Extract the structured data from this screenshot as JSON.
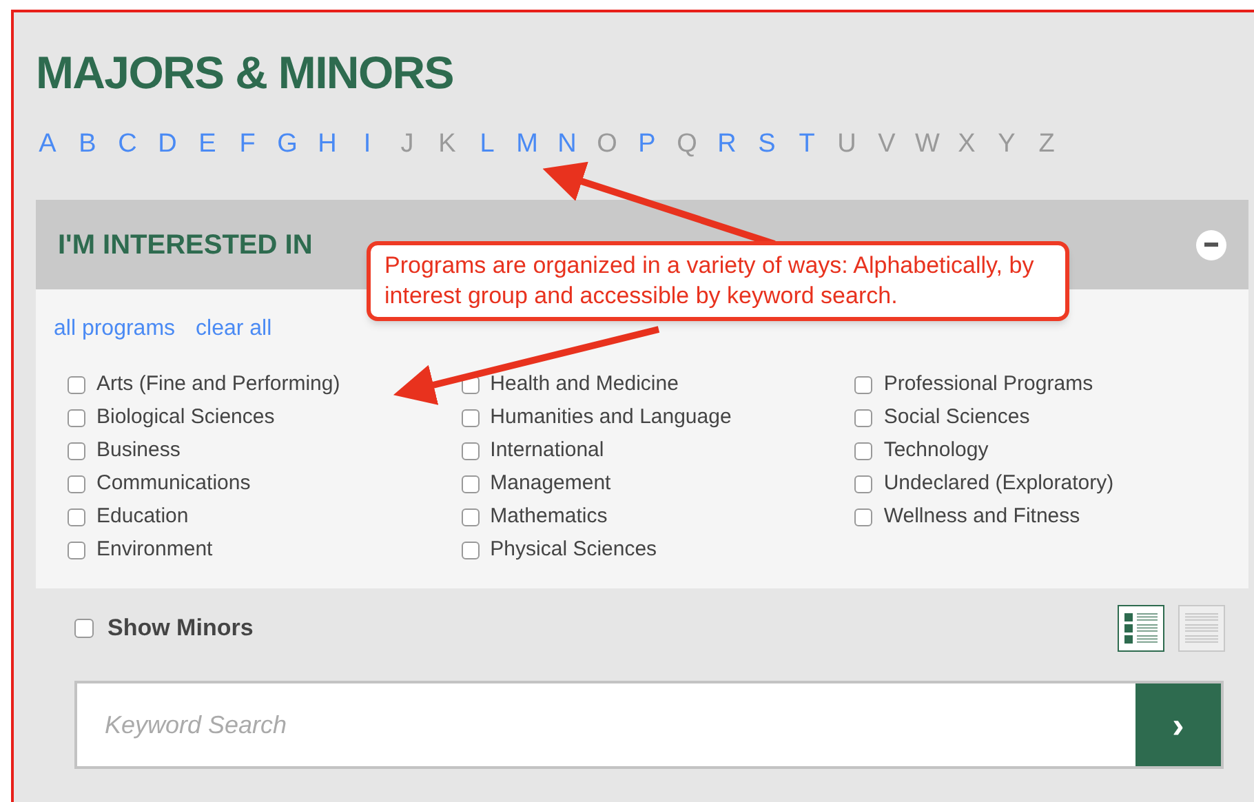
{
  "title": "MAJORS & MINORS",
  "letters": [
    {
      "label": "A",
      "enabled": true
    },
    {
      "label": "B",
      "enabled": true
    },
    {
      "label": "C",
      "enabled": true
    },
    {
      "label": "D",
      "enabled": true
    },
    {
      "label": "E",
      "enabled": true
    },
    {
      "label": "F",
      "enabled": true
    },
    {
      "label": "G",
      "enabled": true
    },
    {
      "label": "H",
      "enabled": true
    },
    {
      "label": "I",
      "enabled": true
    },
    {
      "label": "J",
      "enabled": false
    },
    {
      "label": "K",
      "enabled": false
    },
    {
      "label": "L",
      "enabled": true
    },
    {
      "label": "M",
      "enabled": true
    },
    {
      "label": "N",
      "enabled": true
    },
    {
      "label": "O",
      "enabled": false
    },
    {
      "label": "P",
      "enabled": true
    },
    {
      "label": "Q",
      "enabled": false
    },
    {
      "label": "R",
      "enabled": true
    },
    {
      "label": "S",
      "enabled": true
    },
    {
      "label": "T",
      "enabled": true
    },
    {
      "label": "U",
      "enabled": false
    },
    {
      "label": "V",
      "enabled": false
    },
    {
      "label": "W",
      "enabled": false
    },
    {
      "label": "X",
      "enabled": false
    },
    {
      "label": "Y",
      "enabled": false
    },
    {
      "label": "Z",
      "enabled": false
    }
  ],
  "interest_panel": {
    "title": "I'M INTERESTED IN",
    "expanded": true,
    "links": [
      "all programs",
      "clear all"
    ],
    "columns": [
      [
        {
          "label": "Arts (Fine and Performing)",
          "checked": false
        },
        {
          "label": "Biological Sciences",
          "checked": false
        },
        {
          "label": "Business",
          "checked": false
        },
        {
          "label": "Communications",
          "checked": false
        },
        {
          "label": "Education",
          "checked": false
        },
        {
          "label": "Environment",
          "checked": false
        }
      ],
      [
        {
          "label": "Health and Medicine",
          "checked": false
        },
        {
          "label": "Humanities and Language",
          "checked": false
        },
        {
          "label": "International",
          "checked": false
        },
        {
          "label": "Management",
          "checked": false
        },
        {
          "label": "Mathematics",
          "checked": false
        },
        {
          "label": "Physical Sciences",
          "checked": false
        }
      ],
      [
        {
          "label": "Professional Programs",
          "checked": false
        },
        {
          "label": "Social Sciences",
          "checked": false
        },
        {
          "label": "Technology",
          "checked": false
        },
        {
          "label": "Undeclared (Exploratory)",
          "checked": false
        },
        {
          "label": "Wellness and Fitness",
          "checked": false
        }
      ]
    ]
  },
  "show_minors": {
    "label": "Show Minors",
    "checked": false
  },
  "view_toggle": [
    {
      "kind": "list",
      "selected": true
    },
    {
      "kind": "plain",
      "selected": false
    }
  ],
  "search": {
    "placeholder": "Keyword Search",
    "button": "›"
  },
  "callout": {
    "text": "Programs are organized in a variety of ways: Alphabetically, by interest group and accessible by keyword search."
  }
}
